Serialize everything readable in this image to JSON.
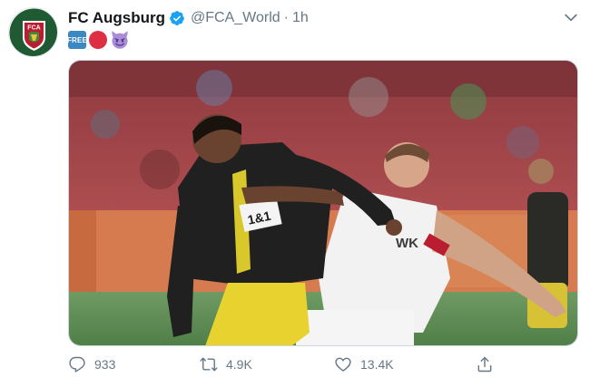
{
  "tweet": {
    "author_name": "FC Augsburg",
    "author_handle": "@FCA_World",
    "separator": "·",
    "time": "1h",
    "avatar_text": "FCA",
    "emojis": [
      {
        "name": "free-button-emoji",
        "text": "FREE",
        "color": "#3b88c3"
      },
      {
        "name": "red-circle-emoji",
        "color": "#dd2e44"
      },
      {
        "name": "smiling-devil-emoji",
        "color": "#aa8dd8"
      }
    ],
    "media": {
      "description_icon": "photo-of-two-footballers",
      "shirt_sponsor_left": "1&1",
      "shirt_sponsor_right": "WK"
    },
    "actions": {
      "reply_count": "933",
      "retweet_count": "4.9K",
      "like_count": "13.4K"
    }
  },
  "colors": {
    "verified": "#1da1f2",
    "muted": "#657786",
    "augsburg_red": "#ba1d2f",
    "augsburg_green": "#3f8a3b"
  }
}
